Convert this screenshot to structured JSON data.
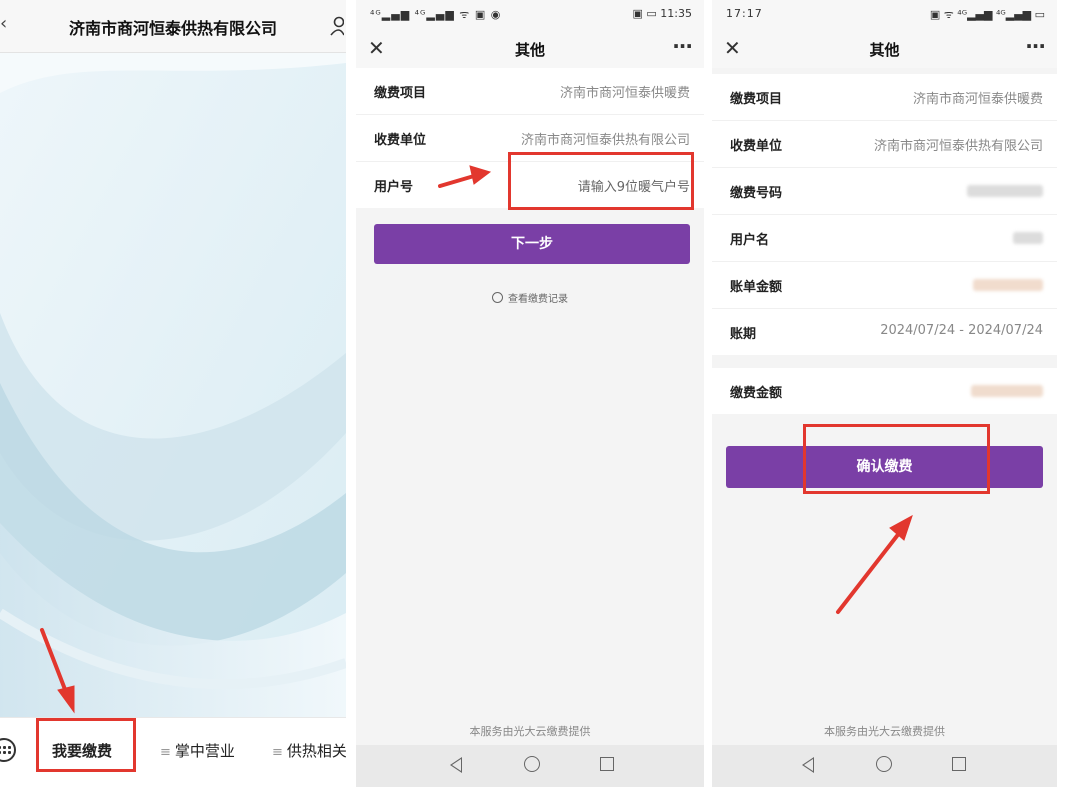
{
  "panel1": {
    "title": "济南市商河恒泰供热有限公司",
    "tabs": [
      {
        "label": "我要缴费"
      },
      {
        "label": "掌中营业"
      },
      {
        "label": "供热相关"
      }
    ]
  },
  "panel2": {
    "status": {
      "left": "⁴ᴳ▂▄▆ ⁴ᴳ▂▄▆ ᯤ ▣ ◉",
      "right": "▣ ▭ 11:35"
    },
    "nav_title": "其他",
    "rows": [
      {
        "label": "缴费项目",
        "value": "济南市商河恒泰供暖费"
      },
      {
        "label": "收费单位",
        "value": "济南市商河恒泰供热有限公司"
      },
      {
        "label": "用户号",
        "placeholder": "请输入9位暖气户号"
      }
    ],
    "next_button": "下一步",
    "history_link": "查看缴费记录",
    "footer": "本服务由光大云缴费提供"
  },
  "panel3": {
    "status": {
      "left": "17:17",
      "right": "▣ ᯤ ⁴ᴳ▂▄▆ ⁴ᴳ▂▄▆ ▭"
    },
    "nav_title": "其他",
    "rows": [
      {
        "label": "缴费项目",
        "value": "济南市商河恒泰供暖费"
      },
      {
        "label": "收费单位",
        "value": "济南市商河恒泰供热有限公司"
      },
      {
        "label": "缴费号码"
      },
      {
        "label": "用户名"
      },
      {
        "label": "账单金额"
      },
      {
        "label": "账期",
        "value": "2024/07/24 - 2024/07/24"
      }
    ],
    "amount_label": "缴费金额",
    "confirm_button": "确认缴费",
    "footer": "本服务由光大云缴费提供"
  },
  "colors": {
    "accent": "#7a3fa6",
    "highlight": "#e2372e"
  }
}
